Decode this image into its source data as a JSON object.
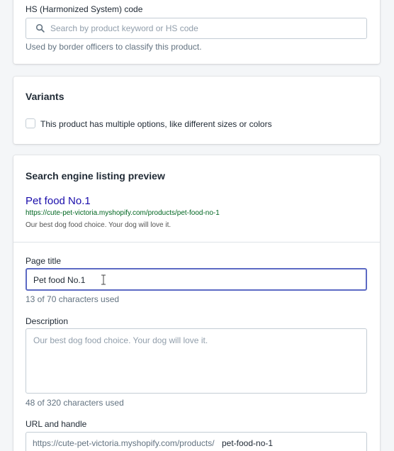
{
  "hs_code": {
    "label": "HS (Harmonized System) code",
    "search_placeholder": "Search by product keyword or HS code",
    "help": "Used by border officers to classify this product."
  },
  "variants": {
    "heading": "Variants",
    "checkbox_label": "This product has multiple options, like different sizes or colors",
    "checked": false
  },
  "seo": {
    "heading": "Search engine listing preview",
    "preview_title": "Pet food No.1",
    "preview_url": "https://cute-pet-victoria.myshopify.com/products/pet-food-no-1",
    "preview_description": "Our best dog food choice. Your dog will love it.",
    "page_title_label": "Page title",
    "page_title_value": "Pet food No.1",
    "page_title_count": "13 of 70 characters used",
    "description_label": "Description",
    "description_value": "Our best dog food choice. Your dog will love it.",
    "description_count": "48 of 320 characters used",
    "url_label": "URL and handle",
    "url_prefix": "https://cute-pet-victoria.myshopify.com/products/",
    "url_handle": "pet-food-no-1"
  },
  "colors": {
    "focus_border": "#5c6ac4",
    "link_blue": "#1a0dab",
    "url_green": "#006621"
  },
  "icons": {
    "search": "search-icon",
    "text_cursor": "text-cursor-icon"
  }
}
